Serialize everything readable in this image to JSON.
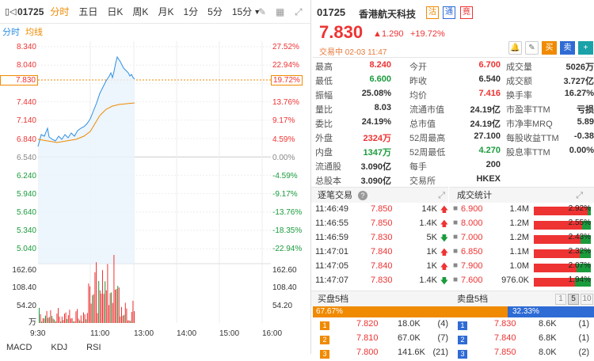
{
  "stock": {
    "code": "01725",
    "name": "香港航天科技",
    "badges": [
      "沽",
      "通",
      "竟"
    ],
    "price": "7.830",
    "change": "1.290",
    "pct": "+19.72%",
    "status": "交易中 02-03 11:47"
  },
  "tabs": [
    "分时",
    "五日",
    "日K",
    "周K",
    "月K",
    "1分",
    "5分",
    "15分"
  ],
  "legend": {
    "a": "分时",
    "b": "均线"
  },
  "left_axis": [
    "8.340",
    "8.040",
    "7.830",
    "7.440",
    "7.140",
    "6.840",
    "6.540",
    "6.240",
    "5.940",
    "5.640",
    "5.340",
    "5.040",
    "162.60",
    "108.40",
    "54.20",
    "万"
  ],
  "right_axis": [
    "27.52%",
    "22.94%",
    "19.72%",
    "13.76%",
    "9.17%",
    "4.59%",
    "0.00%",
    "-4.59%",
    "-9.17%",
    "-13.76%",
    "-18.35%",
    "-22.94%",
    "162.60",
    "108.40",
    "54.20"
  ],
  "time_axis": [
    "9:30",
    "11:00",
    "13:00",
    "14:00",
    "15:00",
    "16:00"
  ],
  "bottom_tabs": [
    "MACD",
    "KDJ",
    "RSI"
  ],
  "actions": {
    "buy": "买",
    "sell": "卖",
    "add": "+"
  },
  "quote": [
    [
      "最高",
      "8.240",
      "今开",
      "6.700",
      "成交量",
      "5026万"
    ],
    [
      "最低",
      "6.600",
      "昨收",
      "6.540",
      "成交额",
      "3.727亿"
    ],
    [
      "振幅",
      "25.08%",
      "均价",
      "7.416",
      "换手率",
      "16.27%"
    ],
    [
      "量比",
      "8.03",
      "流通市值",
      "24.19亿",
      "市盈率TTM",
      "亏损"
    ],
    [
      "委比",
      "24.19%",
      "总市值",
      "24.19亿",
      "市净率MRQ",
      "5.89"
    ],
    [
      "外盘",
      "2324万",
      "52周最高",
      "27.100",
      "每股收益TTM",
      "-0.38"
    ],
    [
      "内盘",
      "1347万",
      "52周最低",
      "4.270",
      "股息率TTM",
      "0.00%"
    ],
    [
      "流通股",
      "3.090亿",
      "每手",
      "200",
      "",
      ""
    ],
    [
      "总股本",
      "3.090亿",
      "交易所",
      "HKEX",
      "",
      ""
    ]
  ],
  "ticks_title": "逐笔交易",
  "stats_title": "成交统计",
  "ticks": [
    [
      "11:46:49",
      "7.850",
      "14K"
    ],
    [
      "11:46:55",
      "7.850",
      "1.4K"
    ],
    [
      "11:46:59",
      "7.830",
      "5K"
    ],
    [
      "11:47:01",
      "7.840",
      "1K"
    ],
    [
      "11:47:05",
      "7.840",
      "1K"
    ],
    [
      "11:47:07",
      "7.830",
      "1.4K"
    ]
  ],
  "stats": [
    [
      "6.900",
      "1.4M",
      "2.92%",
      0.95
    ],
    [
      "8.000",
      "1.2M",
      "2.55%",
      0.85
    ],
    [
      "7.000",
      "1.2M",
      "2.43%",
      0.82
    ],
    [
      "6.850",
      "1.1M",
      "2.32%",
      0.8
    ],
    [
      "7.900",
      "1.0M",
      "2.07%",
      0.75
    ],
    [
      "7.600",
      "976.0K",
      "1.94%",
      0.72
    ]
  ],
  "bid_title": "买盘5档",
  "ask_title": "卖盘5档",
  "bid_pct": "67.67%",
  "ask_pct": "32.33%",
  "depth_btns": [
    "1",
    "5",
    "10"
  ],
  "bids": [
    [
      "1",
      "7.820",
      "18.0K",
      "(4)"
    ],
    [
      "2",
      "7.810",
      "67.0K",
      "(7)"
    ],
    [
      "3",
      "7.800",
      "141.6K",
      "(21)"
    ]
  ],
  "asks": [
    [
      "1",
      "7.830",
      "8.6K",
      "(1)"
    ],
    [
      "2",
      "7.840",
      "6.8K",
      "(1)"
    ],
    [
      "3",
      "7.850",
      "8.0K",
      "(2)"
    ]
  ]
}
